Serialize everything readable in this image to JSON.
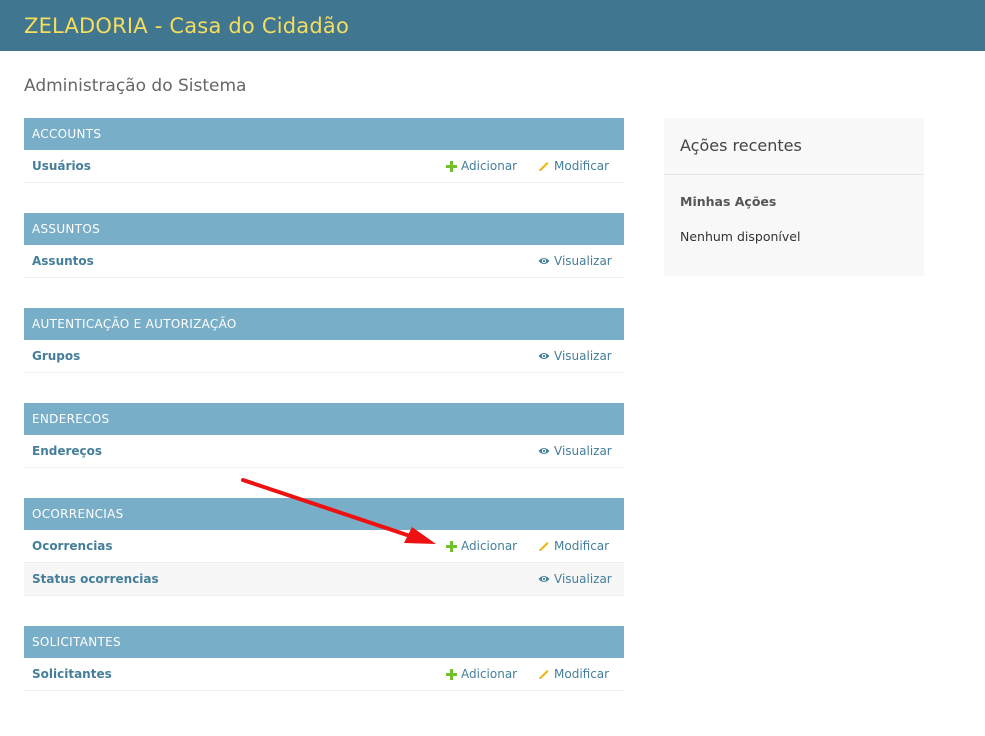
{
  "header": {
    "site_name": "ZELADORIA - Casa do Cidadão"
  },
  "page": {
    "title": "Administração do Sistema"
  },
  "apps": [
    {
      "caption": "ACCOUNTS",
      "models": [
        {
          "name": "Usuários",
          "actions": [
            "add",
            "change"
          ]
        }
      ]
    },
    {
      "caption": "ASSUNTOS",
      "models": [
        {
          "name": "Assuntos",
          "actions": [
            "view"
          ]
        }
      ]
    },
    {
      "caption": "AUTENTICAÇÃO E AUTORIZAÇÃO",
      "models": [
        {
          "name": "Grupos",
          "actions": [
            "view"
          ]
        }
      ]
    },
    {
      "caption": "ENDERECOS",
      "models": [
        {
          "name": "Endereços",
          "actions": [
            "view"
          ]
        }
      ]
    },
    {
      "caption": "OCORRENCIAS",
      "models": [
        {
          "name": "Ocorrencias",
          "actions": [
            "add",
            "change"
          ]
        },
        {
          "name": "Status ocorrencias",
          "actions": [
            "view"
          ]
        }
      ]
    },
    {
      "caption": "SOLICITANTES",
      "models": [
        {
          "name": "Solicitantes",
          "actions": [
            "add",
            "change"
          ]
        }
      ]
    }
  ],
  "labels": {
    "add": "Adicionar",
    "change": "Modificar",
    "view": "Visualizar"
  },
  "icons": {
    "add": "plus-icon",
    "change": "pencil-icon",
    "view": "eye-icon"
  },
  "recent_actions": {
    "title": "Ações recentes",
    "my_actions": "Minhas Ações",
    "empty": "Nenhum disponível"
  },
  "colors": {
    "header_bg": "#417690",
    "branding": "#f5dd5d",
    "module_caption_bg": "#79aec8",
    "link": "#447e9b",
    "add_icon": "#70bf2b",
    "change_icon": "#efb80b",
    "view_icon": "#447e9b",
    "annotation_arrow": "#ee1111"
  }
}
